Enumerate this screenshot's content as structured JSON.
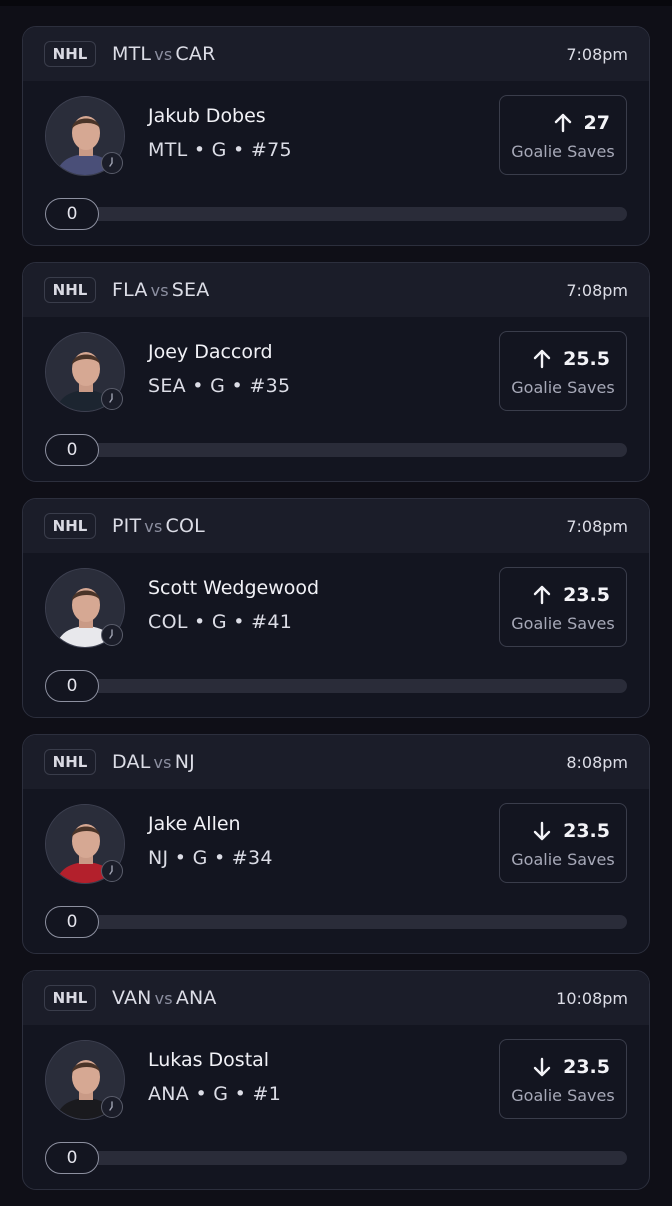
{
  "cards": [
    {
      "league": "NHL",
      "team_a": "MTL",
      "vs": "vs",
      "team_b": "CAR",
      "time": "7:08pm",
      "player_name": "Jakub Dobes",
      "player_meta": "MTL • G • #75",
      "direction": "up",
      "line": "27",
      "stat": "Goalie Saves",
      "progress_value": "0",
      "progress": 0,
      "jersey_color": "#4a4f78"
    },
    {
      "league": "NHL",
      "team_a": "FLA",
      "vs": "vs",
      "team_b": "SEA",
      "time": "7:08pm",
      "player_name": "Joey Daccord",
      "player_meta": "SEA • G • #35",
      "direction": "up",
      "line": "25.5",
      "stat": "Goalie Saves",
      "progress_value": "0",
      "progress": 0,
      "jersey_color": "#1c2530"
    },
    {
      "league": "NHL",
      "team_a": "PIT",
      "vs": "vs",
      "team_b": "COL",
      "time": "7:08pm",
      "player_name": "Scott Wedgewood",
      "player_meta": "COL • G • #41",
      "direction": "up",
      "line": "23.5",
      "stat": "Goalie Saves",
      "progress_value": "0",
      "progress": 0,
      "jersey_color": "#e8e8ec"
    },
    {
      "league": "NHL",
      "team_a": "DAL",
      "vs": "vs",
      "team_b": "NJ",
      "time": "8:08pm",
      "player_name": "Jake Allen",
      "player_meta": "NJ • G • #34",
      "direction": "down",
      "line": "23.5",
      "stat": "Goalie Saves",
      "progress_value": "0",
      "progress": 0,
      "jersey_color": "#b3202c"
    },
    {
      "league": "NHL",
      "team_a": "VAN",
      "vs": "vs",
      "team_b": "ANA",
      "time": "10:08pm",
      "player_name": "Lukas Dostal",
      "player_meta": "ANA • G • #1",
      "direction": "down",
      "line": "23.5",
      "stat": "Goalie Saves",
      "progress_value": "0",
      "progress": 0,
      "jersey_color": "#1a1a1e"
    }
  ]
}
